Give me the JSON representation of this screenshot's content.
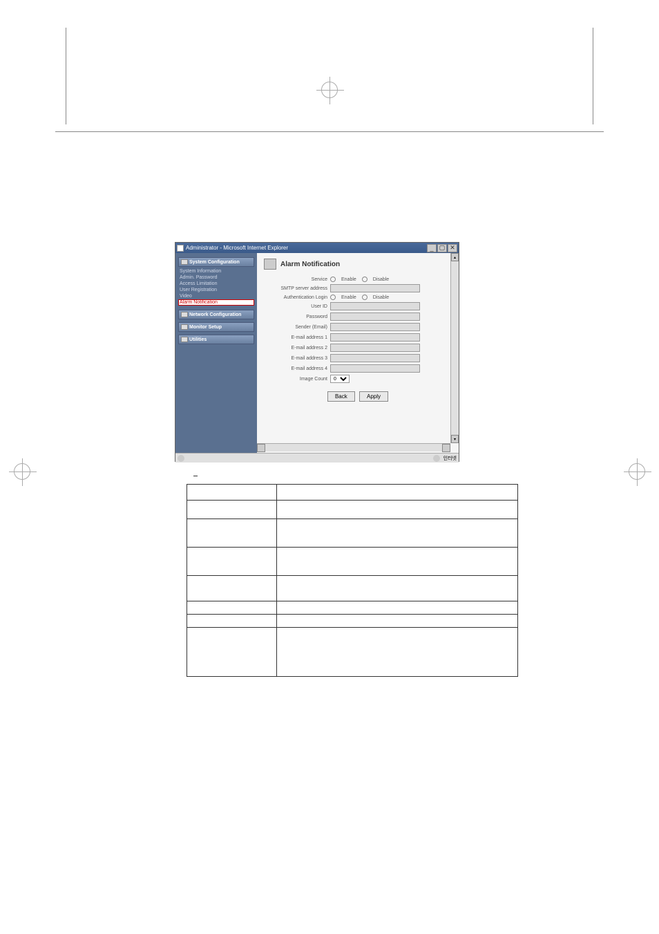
{
  "window": {
    "title": "Administrator - Microsoft Internet Explorer"
  },
  "sidebar": {
    "sections": [
      {
        "title": "System Configuration",
        "links": [
          {
            "label": "System Information",
            "active": false
          },
          {
            "label": "Admin. Password",
            "active": false
          },
          {
            "label": "Access Limitation",
            "active": false
          },
          {
            "label": "User Registration",
            "active": false
          },
          {
            "label": "Video",
            "active": false
          },
          {
            "label": "Alarm Notification",
            "active": true
          }
        ]
      },
      {
        "title": "Network Configuration",
        "links": []
      },
      {
        "title": "Monitor Setup",
        "links": []
      },
      {
        "title": "Utilities",
        "links": []
      }
    ]
  },
  "content": {
    "title": "Alarm Notification",
    "form": {
      "service_label": "Service",
      "smtp_label": "SMTP server address",
      "auth_label": "Authentication Login",
      "userid_label": "User ID",
      "password_label": "Password",
      "sender_label": "Sender (Email)",
      "email1_label": "E-mail address 1",
      "email2_label": "E-mail address 2",
      "email3_label": "E-mail address 3",
      "email4_label": "E-mail address 4",
      "imgcount_label": "Image Count",
      "enable": "Enable",
      "disable": "Disable",
      "imgcount_value": "0"
    },
    "buttons": {
      "back": "Back",
      "apply": "Apply"
    }
  },
  "statusbar": {
    "zone": "인터넷"
  }
}
